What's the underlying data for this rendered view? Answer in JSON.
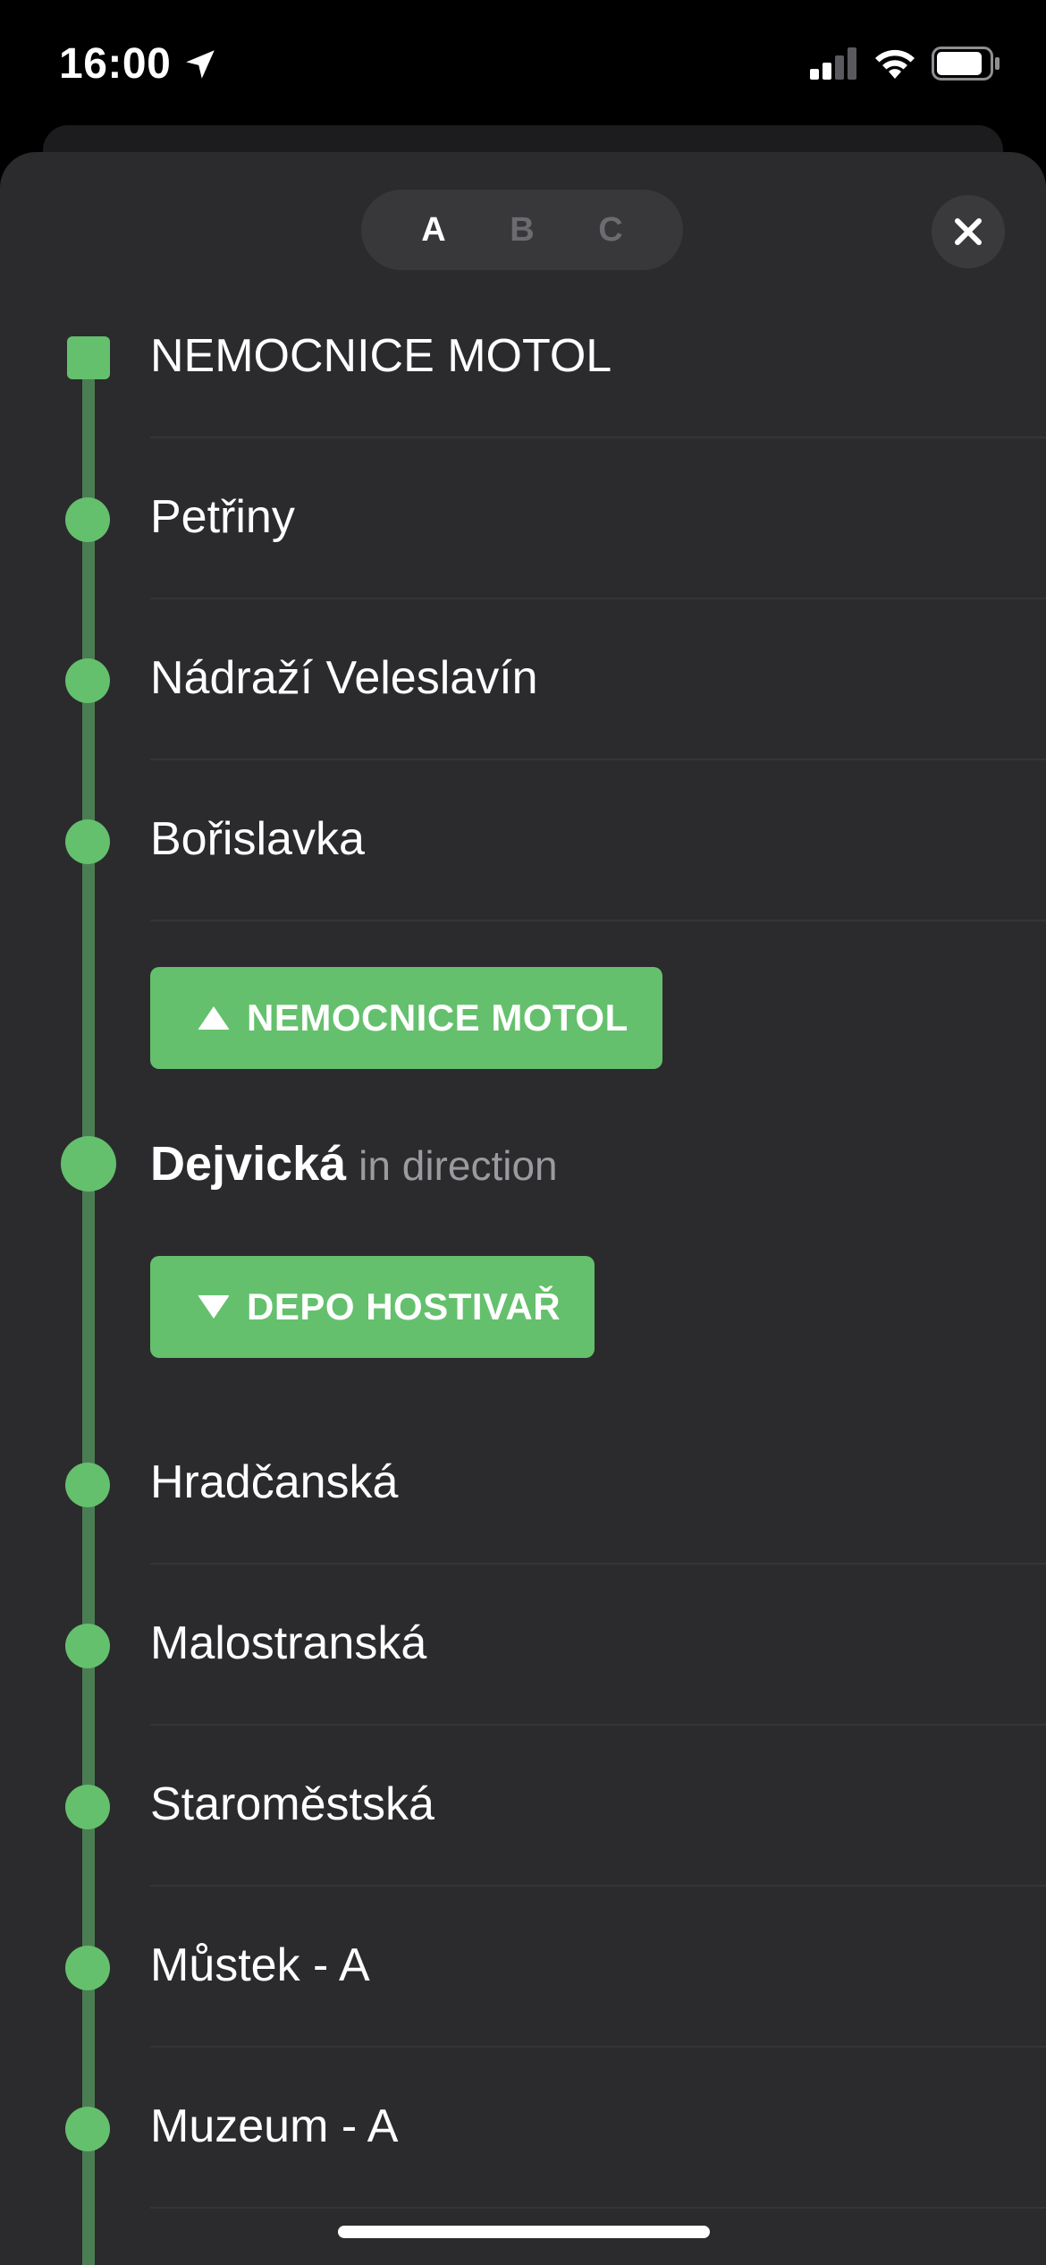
{
  "status_bar": {
    "time": "16:00"
  },
  "selector": {
    "lines": [
      "A",
      "B",
      "C"
    ],
    "active": "A"
  },
  "colors": {
    "line_green": "#64c06d",
    "track_green": "#4b7d53",
    "sheet_bg": "#2b2b2d"
  },
  "stations_before": [
    {
      "name": "NEMOCNICE MOTOL",
      "terminus": true
    },
    {
      "name": "Petřiny"
    },
    {
      "name": "Nádraží Veleslavín"
    },
    {
      "name": "Bořislavka"
    }
  ],
  "current": {
    "name": "Dejvická",
    "subtitle": "in direction",
    "direction_up": "NEMOCNICE MOTOL",
    "direction_down": "DEPO HOSTIVAŘ"
  },
  "stations_after": [
    {
      "name": "Hradčanská"
    },
    {
      "name": "Malostranská"
    },
    {
      "name": "Staroměstská"
    },
    {
      "name": "Můstek - A"
    },
    {
      "name": "Muzeum - A"
    }
  ],
  "icons": {
    "location": "location-arrow-icon",
    "signal": "cellular-signal-icon",
    "wifi": "wifi-icon",
    "battery": "battery-icon",
    "close": "close-icon"
  }
}
